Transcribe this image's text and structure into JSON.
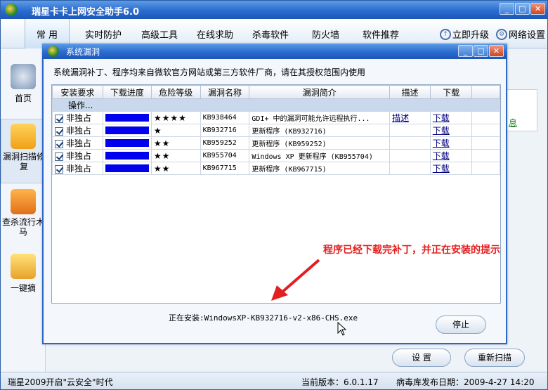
{
  "main_window": {
    "title": "瑞星卡卡上网安全助手6.0",
    "tabs": [
      "常 用",
      "实时防护",
      "高级工具",
      "在线求助",
      "杀毒软件",
      "防火墙",
      "软件推荐"
    ],
    "top_links": [
      "立即升级",
      "网络设置"
    ],
    "sidebar": [
      "首页",
      "漏洞扫描修复",
      "查杀流行木马",
      "一键摘"
    ],
    "bg_link": "息",
    "buttons": {
      "settings": "设 置",
      "rescan": "重新扫描"
    },
    "status": {
      "left": "瑞星2009开启\"云安全\"时代",
      "version": "当前版本：6.0.1.17",
      "virus_date": "病毒库发布日期：2009-4-27 14:20"
    }
  },
  "dialog": {
    "title": "系统漏洞",
    "description": "系统漏洞补丁、程序均来自微软官方网站或第三方软件厂商，请在其授权范围内使用",
    "columns": [
      "安装要求",
      "下载进度",
      "危险等级",
      "漏洞名称",
      "漏洞简介",
      "描述",
      "下载"
    ],
    "group_label": "操作...",
    "rows": [
      {
        "req": "非独占",
        "progress": 1.0,
        "level": "★★★★",
        "kb": "KB938464",
        "brief": "GDI+ 中的漏洞可能允许远程执行...",
        "desc": "描述",
        "download": "下载"
      },
      {
        "req": "非独占",
        "progress": 1.0,
        "level": "★",
        "kb": "KB932716",
        "brief": "更新程序 (KB932716)",
        "desc": "",
        "download": "下载"
      },
      {
        "req": "非独占",
        "progress": 1.0,
        "level": "★★",
        "kb": "KB959252",
        "brief": "更新程序 (KB959252)",
        "desc": "",
        "download": "下载"
      },
      {
        "req": "非独占",
        "progress": 1.0,
        "level": "★★",
        "kb": "KB955704",
        "brief": "Windows XP 更新程序 (KB955704)",
        "desc": "",
        "download": "下载"
      },
      {
        "req": "非独占",
        "progress": 1.0,
        "level": "★★",
        "kb": "KB967715",
        "brief": "更新程序 (KB967715)",
        "desc": "",
        "download": "下载"
      }
    ],
    "annotation": "程序已经下载完补丁，并正在安装的提示",
    "installing": "正在安装:WindowsXP-KB932716-v2-x86-CHS.exe",
    "stop_label": "停止"
  }
}
